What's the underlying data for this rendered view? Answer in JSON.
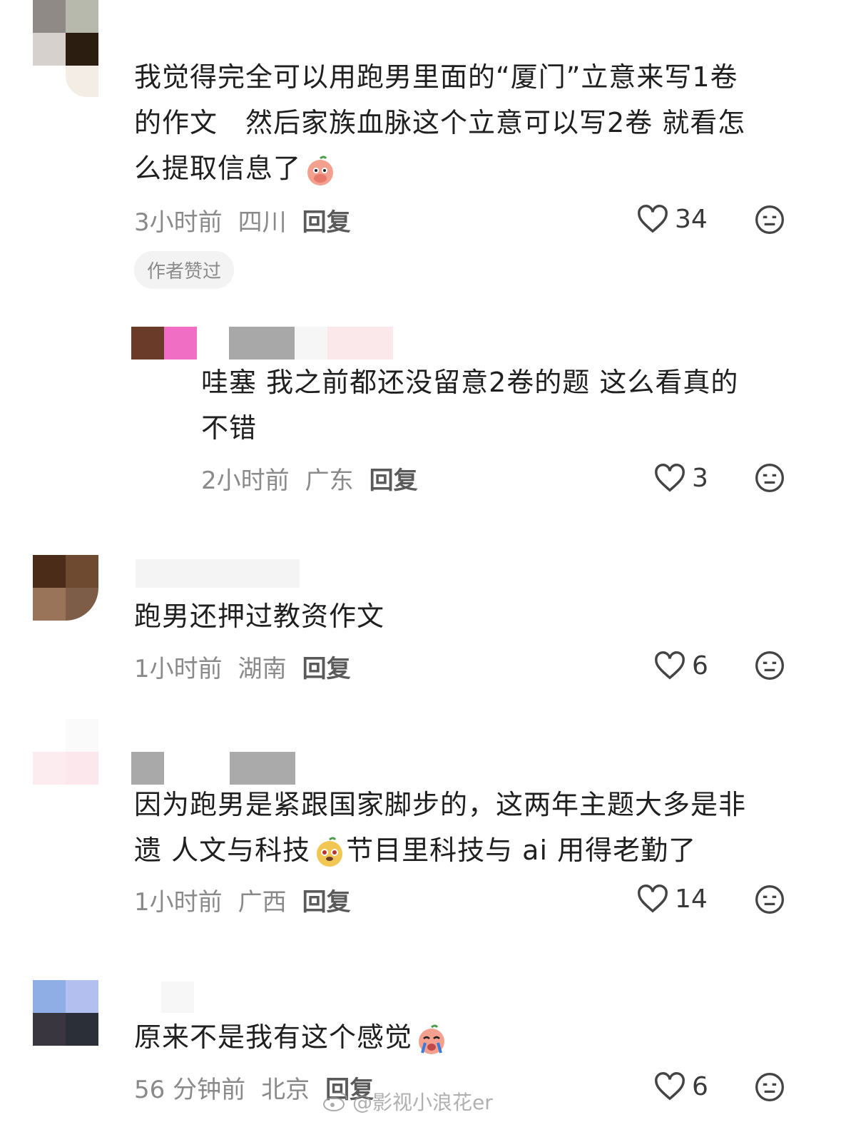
{
  "comments": [
    {
      "text_lines": [
        "我觉得完全可以用跑男里面的“厦门”立意来写1卷",
        "的作文　然后家族血脉这个立意可以写2卷 就看怎",
        "么提取信息了"
      ],
      "time": "3小时前",
      "location": "四川",
      "reply_label": "回复",
      "likes": "34",
      "badge": "作者赞过",
      "emoji": "peach-cover-mouth-emoji"
    },
    {
      "text_lines": [
        "哇塞 我之前都还没留意2卷的题 这么看真的",
        "不错"
      ],
      "time": "2小时前",
      "location": "广东",
      "reply_label": "回复",
      "likes": "3"
    },
    {
      "text_lines": [
        "跑男还押过教资作文"
      ],
      "time": "1小时前",
      "location": "湖南",
      "reply_label": "回复",
      "likes": "6"
    },
    {
      "text_lines": [
        "因为跑男是紧跟国家脚步的，这两年主题大多是非",
        "遗 人文与科技",
        "节目里科技与 ai 用得老勤了"
      ],
      "time": "1小时前",
      "location": "广西",
      "reply_label": "回复",
      "likes": "14",
      "emoji": "puppy-face-emoji"
    },
    {
      "text_lines": [
        "原来不是我有这个感觉"
      ],
      "time": "56 分钟前",
      "location": "北京",
      "reply_label": "回复",
      "likes": "6",
      "emoji": "peach-crying-emoji"
    }
  ],
  "watermark": "@影视小浪花er",
  "icons": {
    "like": "heart-outline-icon",
    "dislike": "meh-face-icon",
    "watermark": "weibo-icon"
  },
  "colors": {
    "text": "#1f1f1f",
    "meta": "#8a8a8a",
    "pill_bg": "#f3f3f3"
  }
}
